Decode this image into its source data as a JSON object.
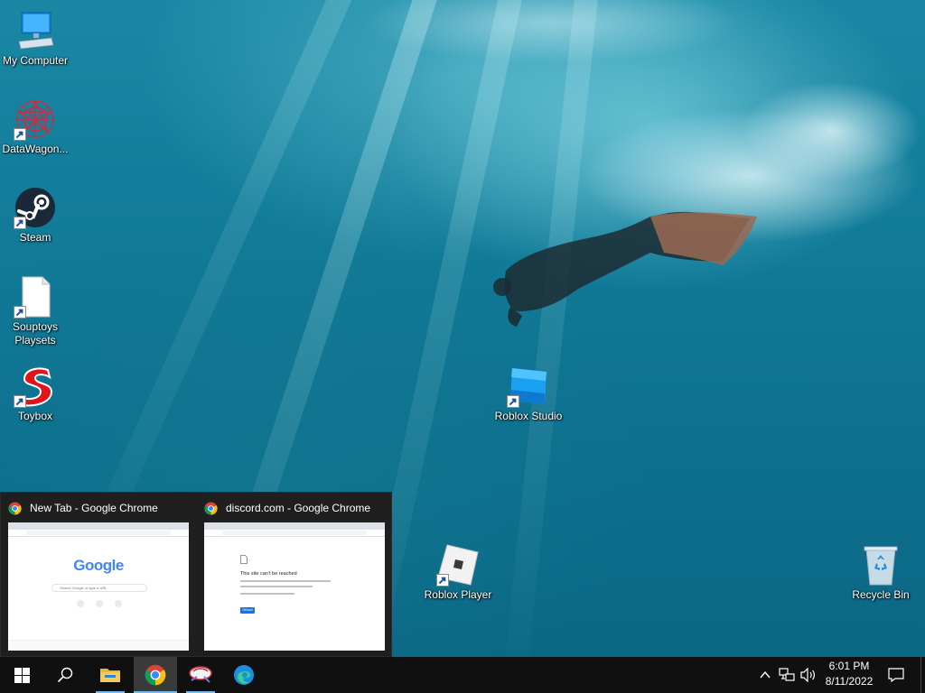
{
  "desktop": {
    "icons": [
      {
        "label": "My Computer"
      },
      {
        "label": "DataWagon..."
      },
      {
        "label": "Steam"
      },
      {
        "label": "Souptoys Playsets"
      },
      {
        "label": "Toybox"
      },
      {
        "label": "Roblox Studio"
      },
      {
        "label": "Roblox Player"
      },
      {
        "label": "Recycle Bin"
      }
    ]
  },
  "previews": [
    {
      "title": "New Tab - Google Chrome",
      "logo_text": "Google",
      "search_placeholder": "Search Google or type a URL"
    },
    {
      "title": "discord.com - Google Chrome",
      "error_heading": "This site can’t be reached",
      "reload_label": "Reload"
    }
  ],
  "taskbar": {
    "start_icon": "windows-logo-icon",
    "search_icon": "search-icon",
    "pinned": [
      {
        "name": "file-explorer-icon"
      },
      {
        "name": "chrome-icon"
      },
      {
        "name": "souptoys-icon"
      },
      {
        "name": "edge-icon"
      }
    ],
    "tray_icons": [
      "chevron-up-icon",
      "network-icon",
      "volume-icon"
    ],
    "clock_time": "6:01 PM",
    "clock_date": "8/11/2022",
    "notification_icon": "action-center-icon"
  },
  "colors": {
    "taskbar_bg": "#101010",
    "active_indicator": "#76b9ed",
    "water": "#0d7391"
  }
}
